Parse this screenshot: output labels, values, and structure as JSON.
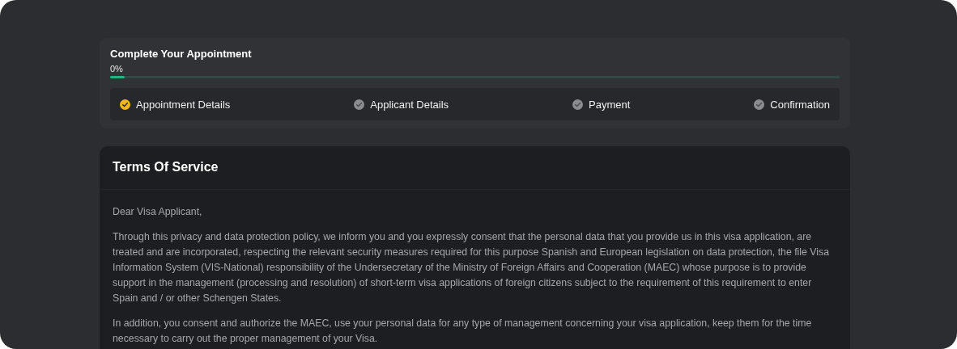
{
  "progress": {
    "title": "Complete Your Appointment",
    "percent": "0%",
    "level": 0,
    "steps": [
      {
        "label": "Appointment Details",
        "completed": true
      },
      {
        "label": "Applicant Details",
        "completed": false
      },
      {
        "label": "Payment",
        "completed": false
      },
      {
        "label": "Confirmation",
        "completed": false
      }
    ]
  },
  "terms": {
    "title": "Terms Of Service",
    "paragraphs": [
      "Dear Visa Applicant,",
      "Through this privacy and data protection policy, we inform you and you expressly consent that the personal data that you provide us in this visa application, are treated and are incorporated, respecting the relevant security measures required for this purpose Spanish and European legislation on data protection, the file Visa Information System (VIS-National) responsibility of the Undersecretary of the Ministry of Foreign Affairs and Cooperation (MAEC) whose purpose is to provide support in the management (processing and resolution) of short-term visa applications of foreign citizens subject to the requirement of this requirement to enter Spain and / or other Schengen States.",
      "In addition, you consent and authorize the MAEC, use your personal data for any type of management concerning your visa application, keep them for the time necessary to carry out the proper management of your Visa."
    ]
  }
}
